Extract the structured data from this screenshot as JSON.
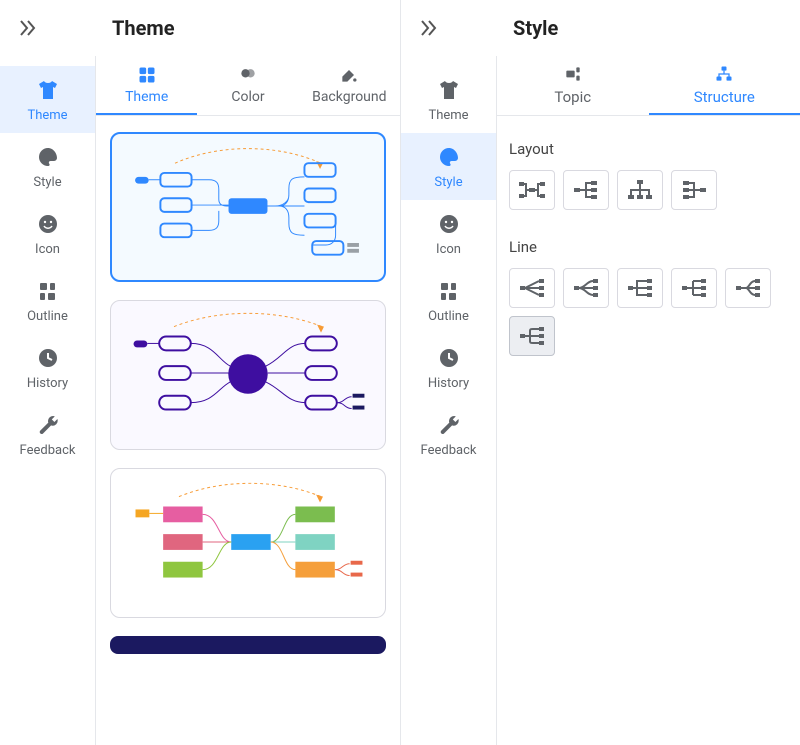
{
  "panel1": {
    "title": "Theme",
    "sidebar": [
      {
        "label": "Theme"
      },
      {
        "label": "Style"
      },
      {
        "label": "Icon"
      },
      {
        "label": "Outline"
      },
      {
        "label": "History"
      },
      {
        "label": "Feedback"
      }
    ],
    "active_sidebar": 0,
    "tabs": [
      {
        "label": "Theme"
      },
      {
        "label": "Color"
      },
      {
        "label": "Background"
      }
    ],
    "active_tab": 0
  },
  "panel2": {
    "title": "Style",
    "sidebar": [
      {
        "label": "Theme"
      },
      {
        "label": "Style"
      },
      {
        "label": "Icon"
      },
      {
        "label": "Outline"
      },
      {
        "label": "History"
      },
      {
        "label": "Feedback"
      }
    ],
    "active_sidebar": 1,
    "tabs": [
      {
        "label": "Topic"
      },
      {
        "label": "Structure"
      }
    ],
    "active_tab": 1,
    "sections": {
      "layout_label": "Layout",
      "line_label": "Line"
    }
  }
}
